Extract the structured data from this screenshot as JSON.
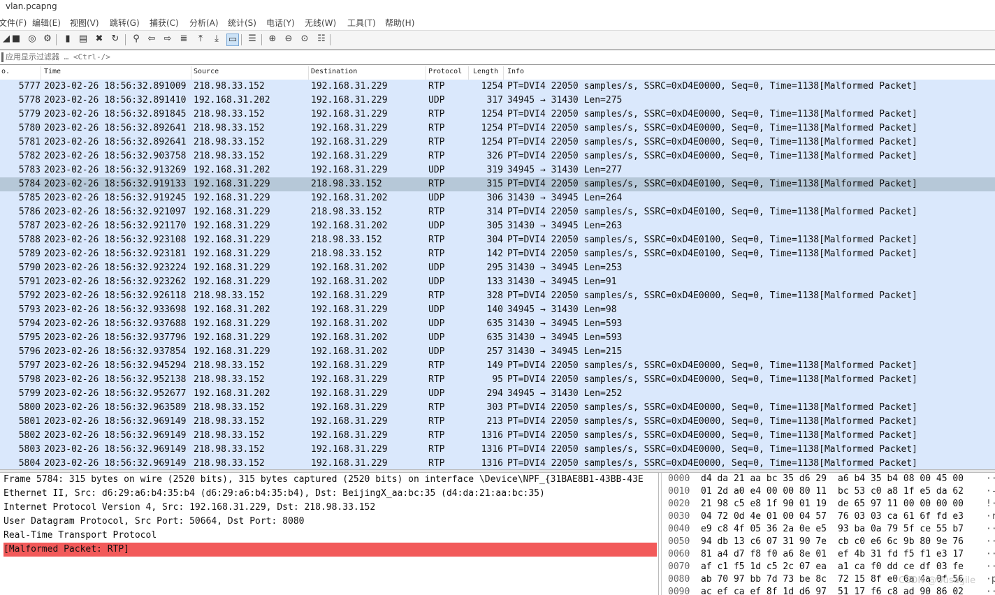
{
  "window": {
    "title": "vlan.pcapng"
  },
  "menu": [
    "文件(F)",
    "编辑(E)",
    "视图(V)",
    "跳转(G)",
    "捕获(C)",
    "分析(A)",
    "统计(S)",
    "电话(Y)",
    "无线(W)",
    "工具(T)",
    "帮助(H)"
  ],
  "toolbar": [
    {
      "name": "start-capture-icon",
      "glyph": "◢"
    },
    {
      "name": "stop-capture-icon",
      "glyph": "■"
    },
    {
      "name": "restart-capture-icon",
      "glyph": "◎"
    },
    {
      "name": "capture-options-icon",
      "glyph": "⚙"
    },
    {
      "name": "open-file-icon",
      "glyph": "▮"
    },
    {
      "name": "save-file-icon",
      "glyph": "▤"
    },
    {
      "name": "close-file-icon",
      "glyph": "✖"
    },
    {
      "name": "reload-file-icon",
      "glyph": "↻"
    },
    {
      "name": "find-packet-icon",
      "glyph": "⚲"
    },
    {
      "name": "go-back-icon",
      "glyph": "⇦"
    },
    {
      "name": "go-forward-icon",
      "glyph": "⇨"
    },
    {
      "name": "go-to-packet-icon",
      "glyph": "≣"
    },
    {
      "name": "first-packet-icon",
      "glyph": "⤒"
    },
    {
      "name": "last-packet-icon",
      "glyph": "⤓"
    },
    {
      "name": "auto-scroll-icon",
      "glyph": "▭"
    },
    {
      "name": "colorize-icon",
      "glyph": "☰"
    },
    {
      "name": "zoom-in-icon",
      "glyph": "⊕"
    },
    {
      "name": "zoom-out-icon",
      "glyph": "⊖"
    },
    {
      "name": "normal-size-icon",
      "glyph": "⊙"
    },
    {
      "name": "resize-columns-icon",
      "glyph": "☷"
    }
  ],
  "filter": {
    "placeholder": "应用显示过滤器 … <Ctrl-/>"
  },
  "columns": {
    "no": "o.",
    "time": "Time",
    "source": "Source",
    "destination": "Destination",
    "protocol": "Protocol",
    "length": "Length",
    "info": "Info"
  },
  "packets": [
    {
      "no": "5777",
      "time": "2023-02-26 18:56:32.891009",
      "src": "218.98.33.152",
      "dst": "192.168.31.229",
      "proto": "RTP",
      "len": "1254",
      "info": "PT=DVI4 22050 samples/s, SSRC=0xD4E0000, Seq=0, Time=1138[Malformed Packet]"
    },
    {
      "no": "5778",
      "time": "2023-02-26 18:56:32.891410",
      "src": "192.168.31.202",
      "dst": "192.168.31.229",
      "proto": "UDP",
      "len": "317",
      "info": "34945 → 31430 Len=275"
    },
    {
      "no": "5779",
      "time": "2023-02-26 18:56:32.891845",
      "src": "218.98.33.152",
      "dst": "192.168.31.229",
      "proto": "RTP",
      "len": "1254",
      "info": "PT=DVI4 22050 samples/s, SSRC=0xD4E0000, Seq=0, Time=1138[Malformed Packet]"
    },
    {
      "no": "5780",
      "time": "2023-02-26 18:56:32.892641",
      "src": "218.98.33.152",
      "dst": "192.168.31.229",
      "proto": "RTP",
      "len": "1254",
      "info": "PT=DVI4 22050 samples/s, SSRC=0xD4E0000, Seq=0, Time=1138[Malformed Packet]"
    },
    {
      "no": "5781",
      "time": "2023-02-26 18:56:32.892641",
      "src": "218.98.33.152",
      "dst": "192.168.31.229",
      "proto": "RTP",
      "len": "1254",
      "info": "PT=DVI4 22050 samples/s, SSRC=0xD4E0000, Seq=0, Time=1138[Malformed Packet]"
    },
    {
      "no": "5782",
      "time": "2023-02-26 18:56:32.903758",
      "src": "218.98.33.152",
      "dst": "192.168.31.229",
      "proto": "RTP",
      "len": "326",
      "info": "PT=DVI4 22050 samples/s, SSRC=0xD4E0000, Seq=0, Time=1138[Malformed Packet]"
    },
    {
      "no": "5783",
      "time": "2023-02-26 18:56:32.913269",
      "src": "192.168.31.202",
      "dst": "192.168.31.229",
      "proto": "UDP",
      "len": "319",
      "info": "34945 → 31430 Len=277"
    },
    {
      "no": "5784",
      "time": "2023-02-26 18:56:32.919133",
      "src": "192.168.31.229",
      "dst": "218.98.33.152",
      "proto": "RTP",
      "len": "315",
      "info": "PT=DVI4 22050 samples/s, SSRC=0xD4E0100, Seq=0, Time=1138[Malformed Packet]",
      "selected": true
    },
    {
      "no": "5785",
      "time": "2023-02-26 18:56:32.919245",
      "src": "192.168.31.229",
      "dst": "192.168.31.202",
      "proto": "UDP",
      "len": "306",
      "info": "31430 → 34945 Len=264"
    },
    {
      "no": "5786",
      "time": "2023-02-26 18:56:32.921097",
      "src": "192.168.31.229",
      "dst": "218.98.33.152",
      "proto": "RTP",
      "len": "314",
      "info": "PT=DVI4 22050 samples/s, SSRC=0xD4E0100, Seq=0, Time=1138[Malformed Packet]"
    },
    {
      "no": "5787",
      "time": "2023-02-26 18:56:32.921170",
      "src": "192.168.31.229",
      "dst": "192.168.31.202",
      "proto": "UDP",
      "len": "305",
      "info": "31430 → 34945 Len=263"
    },
    {
      "no": "5788",
      "time": "2023-02-26 18:56:32.923108",
      "src": "192.168.31.229",
      "dst": "218.98.33.152",
      "proto": "RTP",
      "len": "304",
      "info": "PT=DVI4 22050 samples/s, SSRC=0xD4E0100, Seq=0, Time=1138[Malformed Packet]"
    },
    {
      "no": "5789",
      "time": "2023-02-26 18:56:32.923181",
      "src": "192.168.31.229",
      "dst": "218.98.33.152",
      "proto": "RTP",
      "len": "142",
      "info": "PT=DVI4 22050 samples/s, SSRC=0xD4E0100, Seq=0, Time=1138[Malformed Packet]"
    },
    {
      "no": "5790",
      "time": "2023-02-26 18:56:32.923224",
      "src": "192.168.31.229",
      "dst": "192.168.31.202",
      "proto": "UDP",
      "len": "295",
      "info": "31430 → 34945 Len=253"
    },
    {
      "no": "5791",
      "time": "2023-02-26 18:56:32.923262",
      "src": "192.168.31.229",
      "dst": "192.168.31.202",
      "proto": "UDP",
      "len": "133",
      "info": "31430 → 34945 Len=91"
    },
    {
      "no": "5792",
      "time": "2023-02-26 18:56:32.926118",
      "src": "218.98.33.152",
      "dst": "192.168.31.229",
      "proto": "RTP",
      "len": "328",
      "info": "PT=DVI4 22050 samples/s, SSRC=0xD4E0000, Seq=0, Time=1138[Malformed Packet]"
    },
    {
      "no": "5793",
      "time": "2023-02-26 18:56:32.933698",
      "src": "192.168.31.202",
      "dst": "192.168.31.229",
      "proto": "UDP",
      "len": "140",
      "info": "34945 → 31430 Len=98"
    },
    {
      "no": "5794",
      "time": "2023-02-26 18:56:32.937688",
      "src": "192.168.31.229",
      "dst": "192.168.31.202",
      "proto": "UDP",
      "len": "635",
      "info": "31430 → 34945 Len=593"
    },
    {
      "no": "5795",
      "time": "2023-02-26 18:56:32.937796",
      "src": "192.168.31.229",
      "dst": "192.168.31.202",
      "proto": "UDP",
      "len": "635",
      "info": "31430 → 34945 Len=593"
    },
    {
      "no": "5796",
      "time": "2023-02-26 18:56:32.937854",
      "src": "192.168.31.229",
      "dst": "192.168.31.202",
      "proto": "UDP",
      "len": "257",
      "info": "31430 → 34945 Len=215"
    },
    {
      "no": "5797",
      "time": "2023-02-26 18:56:32.945294",
      "src": "218.98.33.152",
      "dst": "192.168.31.229",
      "proto": "RTP",
      "len": "149",
      "info": "PT=DVI4 22050 samples/s, SSRC=0xD4E0000, Seq=0, Time=1138[Malformed Packet]"
    },
    {
      "no": "5798",
      "time": "2023-02-26 18:56:32.952138",
      "src": "218.98.33.152",
      "dst": "192.168.31.229",
      "proto": "RTP",
      "len": "95",
      "info": "PT=DVI4 22050 samples/s, SSRC=0xD4E0000, Seq=0, Time=1138[Malformed Packet]"
    },
    {
      "no": "5799",
      "time": "2023-02-26 18:56:32.952677",
      "src": "192.168.31.202",
      "dst": "192.168.31.229",
      "proto": "UDP",
      "len": "294",
      "info": "34945 → 31430 Len=252"
    },
    {
      "no": "5800",
      "time": "2023-02-26 18:56:32.963589",
      "src": "218.98.33.152",
      "dst": "192.168.31.229",
      "proto": "RTP",
      "len": "303",
      "info": "PT=DVI4 22050 samples/s, SSRC=0xD4E0000, Seq=0, Time=1138[Malformed Packet]"
    },
    {
      "no": "5801",
      "time": "2023-02-26 18:56:32.969149",
      "src": "218.98.33.152",
      "dst": "192.168.31.229",
      "proto": "RTP",
      "len": "213",
      "info": "PT=DVI4 22050 samples/s, SSRC=0xD4E0000, Seq=0, Time=1138[Malformed Packet]"
    },
    {
      "no": "5802",
      "time": "2023-02-26 18:56:32.969149",
      "src": "218.98.33.152",
      "dst": "192.168.31.229",
      "proto": "RTP",
      "len": "1316",
      "info": "PT=DVI4 22050 samples/s, SSRC=0xD4E0000, Seq=0, Time=1138[Malformed Packet]"
    },
    {
      "no": "5803",
      "time": "2023-02-26 18:56:32.969149",
      "src": "218.98.33.152",
      "dst": "192.168.31.229",
      "proto": "RTP",
      "len": "1316",
      "info": "PT=DVI4 22050 samples/s, SSRC=0xD4E0000, Seq=0, Time=1138[Malformed Packet]"
    },
    {
      "no": "5804",
      "time": "2023-02-26 18:56:32.969149",
      "src": "218.98.33.152",
      "dst": "192.168.31.229",
      "proto": "RTP",
      "len": "1316",
      "info": "PT=DVI4 22050 samples/s, SSRC=0xD4E0000, Seq=0, Time=1138[Malformed Packet]"
    }
  ],
  "details": [
    {
      "text": "Frame 5784: 315 bytes on wire (2520 bits), 315 bytes captured (2520 bits) on interface \\Device\\NPF_{31BAE8B1-43BB-43E"
    },
    {
      "text": "Ethernet II, Src: d6:29:a6:b4:35:b4 (d6:29:a6:b4:35:b4), Dst: BeijingX_aa:bc:35 (d4:da:21:aa:bc:35)"
    },
    {
      "text": "Internet Protocol Version 4, Src: 192.168.31.229, Dst: 218.98.33.152"
    },
    {
      "text": "User Datagram Protocol, Src Port: 50664, Dst Port: 8080"
    },
    {
      "text": "Real-Time Transport Protocol"
    },
    {
      "text": "[Malformed Packet: RTP]",
      "error": true
    }
  ],
  "hex": [
    {
      "off": "0000",
      "b1": "d4 da 21 aa bc 35 d6 29",
      "b2": "a6 b4 35 b4 08 00 45 00",
      "asc": "··"
    },
    {
      "off": "0010",
      "b1": "01 2d a0 e4 00 00 80 11",
      "b2": "bc 53 c0 a8 1f e5 da 62",
      "asc": "·-"
    },
    {
      "off": "0020",
      "b1": "21 98 c5 e8 1f 90 01 19",
      "b2": "de 65 97 11 00 00 00 00",
      "asc": "!·"
    },
    {
      "off": "0030",
      "b1": "04 72 0d 4e 01 00 04 57",
      "b2": "76 03 03 ca 61 6f fd e3",
      "asc": "·r"
    },
    {
      "off": "0040",
      "b1": "e9 c8 4f 05 36 2a 0e e5",
      "b2": "93 ba 0a 79 5f ce 55 b7",
      "asc": "··"
    },
    {
      "off": "0050",
      "b1": "94 db 13 c6 07 31 90 7e",
      "b2": "cb c0 e6 6c 9b 80 9e 76",
      "asc": "··"
    },
    {
      "off": "0060",
      "b1": "81 a4 d7 f8 f0 a6 8e 01",
      "b2": "ef 4b 31 fd f5 f1 e3 17",
      "asc": "··"
    },
    {
      "off": "0070",
      "b1": "af c1 f5 1d c5 2c 07 ea",
      "b2": "a1 ca f0 dd ce df 03 fe",
      "asc": "··"
    },
    {
      "off": "0080",
      "b1": "ab 70 97 bb 7d 73 be 8c",
      "b2": "72 15 8f e0 6a 4a 0f 56",
      "asc": "·p"
    },
    {
      "off": "0090",
      "b1": "ac ef ca ef 8f 1d d6 97",
      "b2": "51 17 f6 c8 ad 90 86 02",
      "asc": "··"
    }
  ],
  "watermark": "CSDN @Uusagile"
}
